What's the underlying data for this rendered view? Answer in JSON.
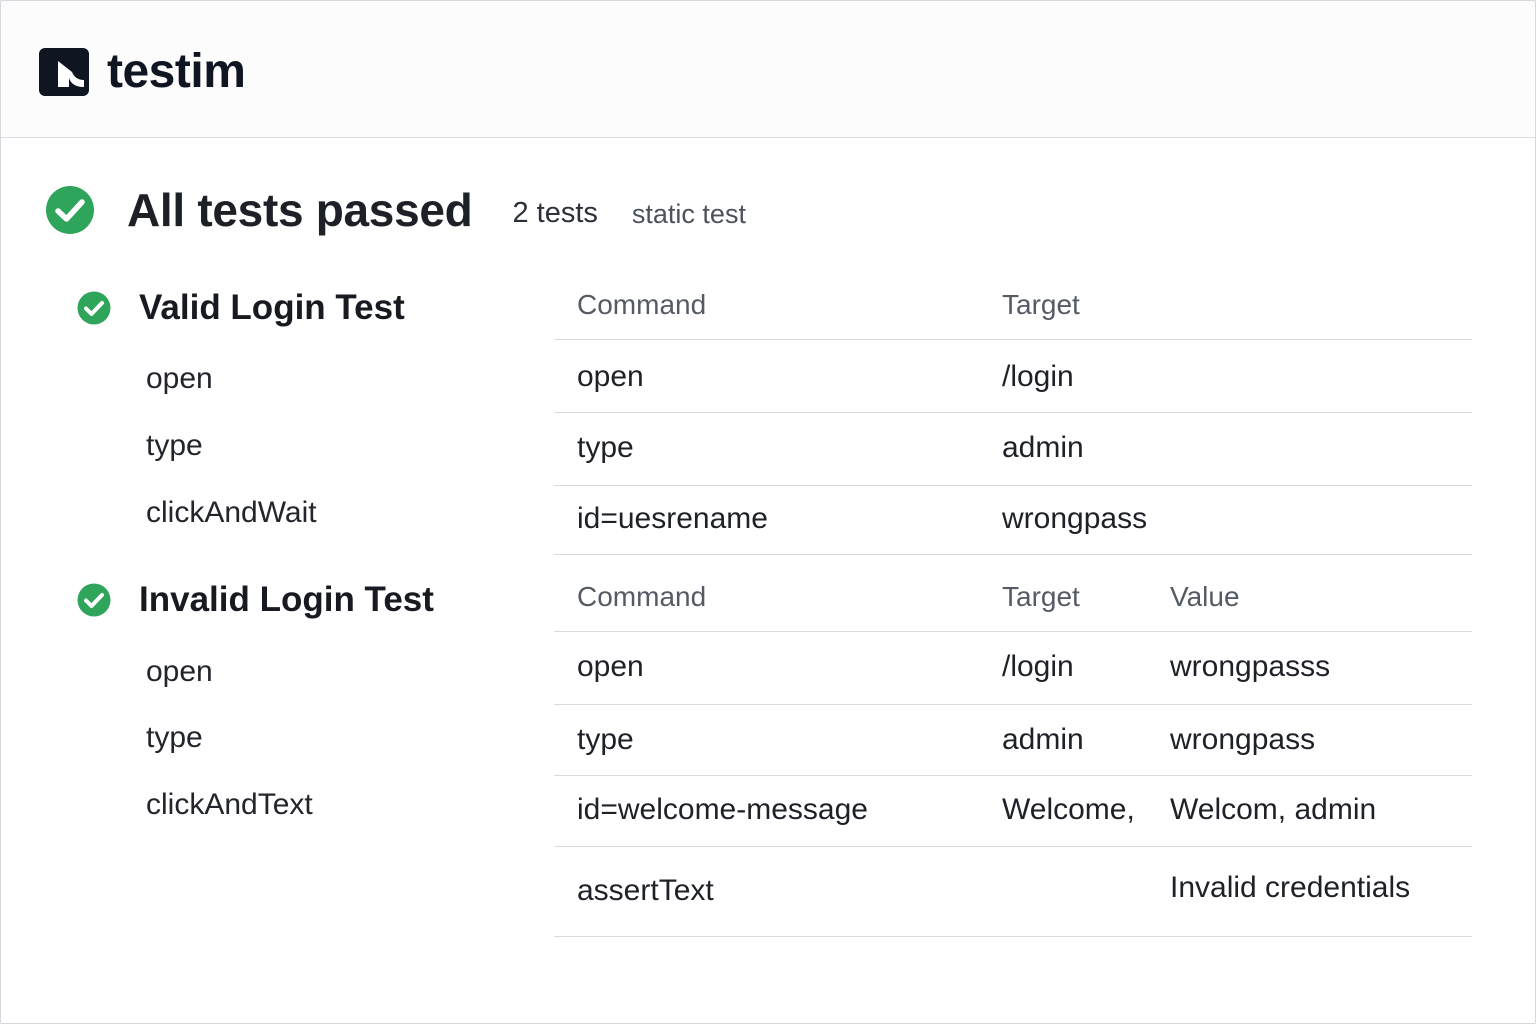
{
  "app": {
    "name": "testim",
    "colors": {
      "brand": "#101522",
      "success": "#2ea55a"
    }
  },
  "summary": {
    "status_icon": "check-circle-icon",
    "title": "All tests passed",
    "count": "2 tests",
    "kind": "static test"
  },
  "suites": [
    {
      "name": "Valid Login Test",
      "status_icon": "check-circle-icon",
      "steps": [
        "open",
        "type",
        "clickAndWait"
      ],
      "table": {
        "headers": [
          "Command",
          "Target"
        ],
        "rows": [
          [
            "open",
            "/login"
          ],
          [
            "type",
            "admin"
          ],
          [
            "id=uesrename",
            "wrongpass"
          ]
        ]
      }
    },
    {
      "name": "Invalid Login Test",
      "status_icon": "check-circle-icon",
      "steps": [
        "open",
        "type",
        "clickAndText"
      ],
      "table": {
        "headers": [
          "Command",
          "Target",
          "Value"
        ],
        "rows": [
          [
            "open",
            "/login",
            "wrongpasss"
          ],
          [
            "type",
            "admin",
            "wrongpass"
          ],
          [
            "id=welcome-message",
            "Welcome,",
            "Welcom, admin"
          ],
          [
            "assertText",
            "",
            "Invalid credentials"
          ]
        ]
      }
    }
  ]
}
